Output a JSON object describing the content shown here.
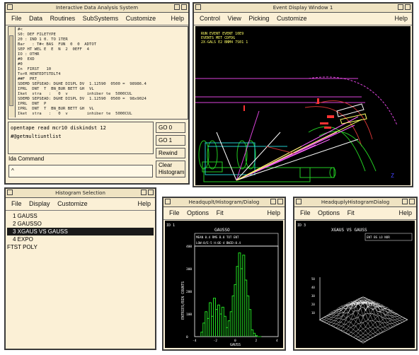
{
  "main_window": {
    "title": "Interactive Data Analysis System",
    "menu": [
      "File",
      "Data",
      "Routines",
      "SubSystems",
      "Customize"
    ],
    "help": "Help",
    "log_lines": [
      "#<",
      "S0: DEF FILETYPE",
      "20 : IND 1 0. TO 1TER",
      "Bar   : T#< BAS  FUN  0  0  ADTOT",
      "SEP HT WEL E  E  N  2  0EFF  4",
      "IO : OTHR",
      "#0  EXD",
      "#0",
      "In  FIRST   10",
      "TorR HENTEDTSTDLT4",
      "##F  PRT_",
      "SDEMD SEPSEAD: DGHE DISPL DV  1.12590  0500 =  98986.4",
      "IPRL  DNT  T  BN_BUR BETT GH  VL",
      "Iket  stra   :   0  v        inhiber te  5000CUL",
      "SDEMD SEPSEAD: DGHE DISPL DV  1.12590  0500 =  98x9024",
      "IPRL  DNT  P",
      "IPRL  DNT  T  BN_BUR BETT GH  VL",
      "Iket  stra   :   0  v        inhiber te  5000CUL"
    ],
    "cmd_lines": [
      "opentape read mcr10  diskindst  12",
      "#@getmultiuntlist"
    ],
    "idle_label": "Ida Command",
    "buttons": [
      "GO 0",
      "GO 1",
      "Rewind",
      "Clear Histogram"
    ]
  },
  "event_window": {
    "title": "Event Display    Window 1",
    "menu": [
      "Control",
      "View",
      "Picking",
      "Customize"
    ],
    "help": "Help",
    "info_lines": [
      "RUN  EVENT   EVENT  10E9",
      "EVENTS  MET    CDFDG",
      "2X-GALS E2 BNM4    7S01  1"
    ],
    "z_label": "Z"
  },
  "hist_window": {
    "title": "Histogram  Selection",
    "menu": [
      "File",
      "Display",
      "Customize"
    ],
    "help": "Help",
    "items": [
      "1 GAUSS",
      "2 GAUSSO",
      "3 XGAUS  VS GAUSS",
      "4 EXPO",
      "FTST POLY"
    ],
    "selected_index": 2
  },
  "plot1d_window": {
    "title": "Headquplt/Histogram/Dialog",
    "menu": [
      "File",
      "Options",
      "Fit"
    ],
    "help": "Help",
    "id_label": "ID    1",
    "plot_title": "GAUSSO",
    "stats_row": "MEAN 0.4  RMS  B.8  TOT  ENT",
    "stats_row2": "LOW:0/E-5 H:0E-4  BWID:0.4",
    "ylabel": "ENTRIES/BIN  COUNTS",
    "xlabel": "GAUSS",
    "yticks": [
      "400",
      "300",
      "200",
      "100",
      "0"
    ],
    "xticks": [
      "-4",
      "-2",
      "0",
      "2",
      "4"
    ]
  },
  "plot2d_window": {
    "title": "HeadquplyHistogramDialog",
    "menu": [
      "File",
      "Options",
      "Fit"
    ],
    "help": "Help",
    "id_label": "ID     3",
    "plot_title": "XGAUS  VS GAUSS",
    "stats_row": "ENT  BS  LO  NOR",
    "zticks": [
      "50",
      "40",
      "30",
      "20",
      "10"
    ]
  },
  "chart_data": [
    {
      "type": "bar",
      "title": "GAUSSO",
      "xlabel": "GAUSS",
      "ylabel": "ENTRIES/BIN  COUNTS",
      "ylim": [
        0,
        400
      ],
      "x": [
        -3.4,
        -3.2,
        -3.0,
        -2.8,
        -2.6,
        -2.4,
        -2.2,
        -2.0,
        -1.8,
        -1.6,
        -1.4,
        -1.2,
        -1.0,
        -0.8,
        -0.6,
        -0.4,
        -0.2,
        0.0,
        0.2,
        0.4,
        0.6,
        0.8,
        1.0,
        1.2,
        1.4,
        1.6,
        1.8,
        2.0,
        2.2
      ],
      "values": [
        20,
        60,
        110,
        80,
        150,
        90,
        170,
        120,
        140,
        100,
        130,
        90,
        40,
        70,
        110,
        180,
        230,
        310,
        370,
        300,
        360,
        250,
        180,
        120,
        30,
        15,
        5,
        0,
        0
      ]
    },
    {
      "type": "heatmap",
      "title": "XGAUS  VS GAUSS",
      "zlim": [
        0,
        50
      ]
    }
  ]
}
